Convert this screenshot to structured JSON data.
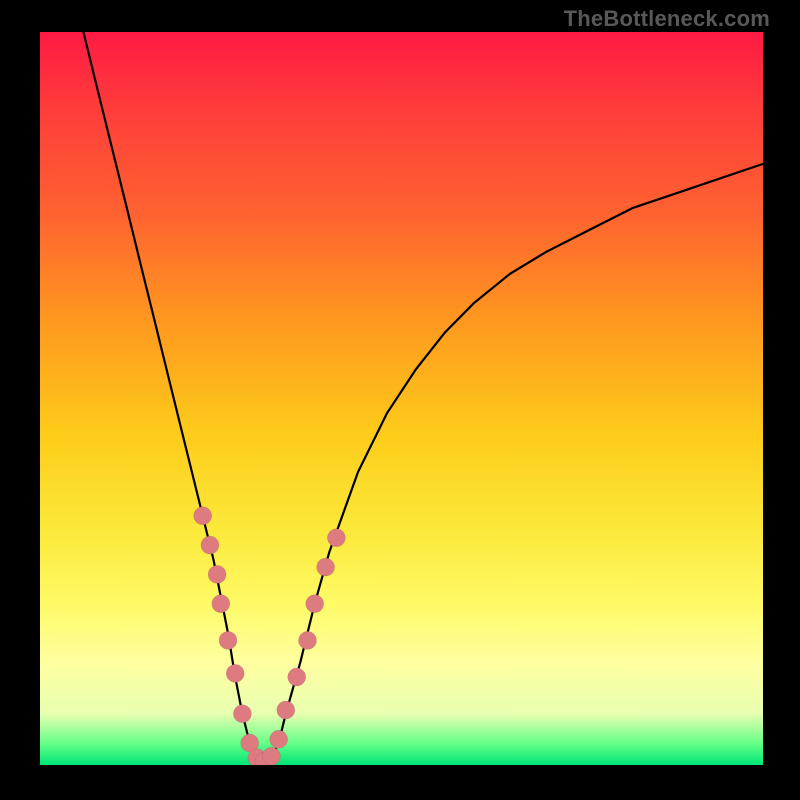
{
  "watermark": "TheBottleneck.com",
  "chart_data": {
    "type": "line",
    "title": "",
    "xlabel": "",
    "ylabel": "",
    "xlim": [
      0,
      100
    ],
    "ylim": [
      0,
      100
    ],
    "grid": false,
    "legend": null,
    "series": [
      {
        "name": "bottleneck-curve",
        "x": [
          6,
          8,
          10,
          12,
          14,
          16,
          18,
          20,
          22,
          24,
          26,
          27,
          28,
          29,
          30,
          31,
          32,
          33,
          34,
          36,
          38,
          40,
          44,
          48,
          52,
          56,
          60,
          65,
          70,
          76,
          82,
          88,
          94,
          100
        ],
        "y": [
          100,
          92,
          84,
          76,
          68,
          60,
          52,
          44,
          36,
          28,
          18,
          12,
          7,
          3,
          1,
          0,
          1,
          3,
          7,
          14,
          22,
          29,
          40,
          48,
          54,
          59,
          63,
          67,
          70,
          73,
          76,
          78,
          80,
          82
        ]
      }
    ],
    "markers": {
      "name": "highlighted-points",
      "color": "#de7b80",
      "x": [
        22.5,
        23.5,
        24.5,
        25.0,
        26.0,
        27.0,
        28.0,
        29.0,
        30.0,
        31.0,
        32.0,
        33.0,
        34.0,
        35.5,
        37.0,
        38.0,
        39.5,
        41.0
      ],
      "y": [
        34.0,
        30.0,
        26.0,
        22.0,
        17.0,
        12.5,
        7.0,
        3.0,
        1.0,
        0.5,
        1.2,
        3.5,
        7.5,
        12.0,
        17.0,
        22.0,
        27.0,
        31.0
      ]
    },
    "colors": {
      "curve": "#000000",
      "marker": "#de7b80",
      "gradient_top": "#ff1a44",
      "gradient_bottom": "#00e676",
      "frame": "#000000"
    }
  }
}
